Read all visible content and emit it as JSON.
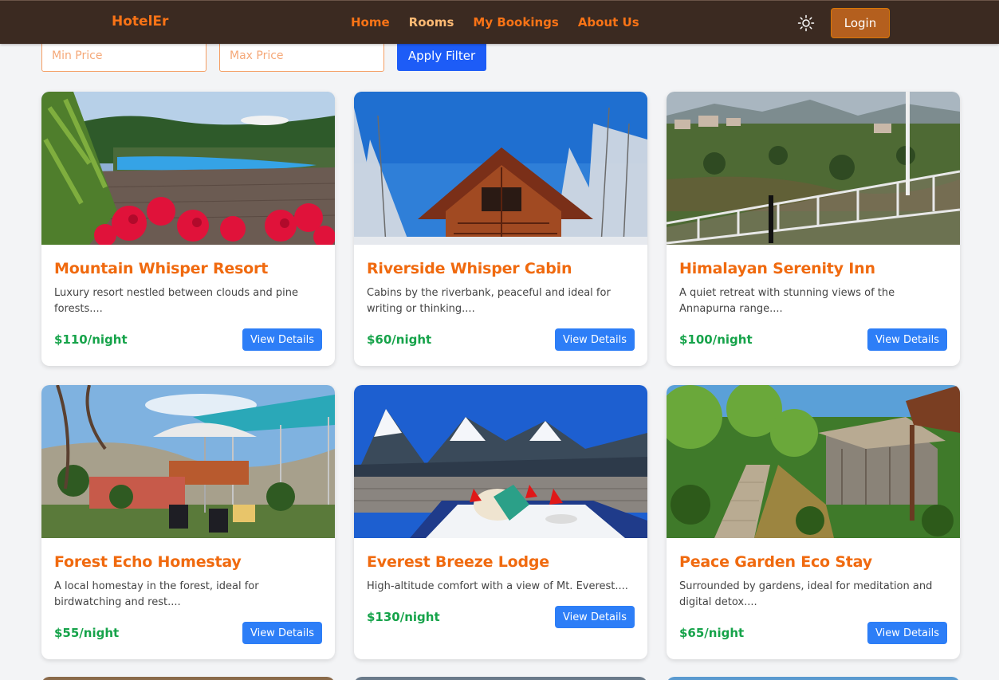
{
  "navbar": {
    "brand": "HotelEr",
    "links": [
      {
        "label": "Home"
      },
      {
        "label": "Rooms"
      },
      {
        "label": "My Bookings"
      },
      {
        "label": "About Us"
      }
    ],
    "login_label": "Login"
  },
  "filter": {
    "min_placeholder": "Min Price",
    "max_placeholder": "Max Price",
    "apply_label": "Apply Filter"
  },
  "button_label": "View Details",
  "rooms": [
    {
      "title": "Mountain Whisper Resort",
      "description": "Luxury resort nestled between clouds and pine forests....",
      "price": "$110/night",
      "image": "pool-flowers"
    },
    {
      "title": "Riverside Whisper Cabin",
      "description": "Cabins by the riverbank, peaceful and ideal for writing or thinking....",
      "price": "$60/night",
      "image": "snow-cabin"
    },
    {
      "title": "Himalayan Serenity Inn",
      "description": "A quiet retreat with stunning views of the Annapurna range....",
      "price": "$100/night",
      "image": "valley-balcony"
    },
    {
      "title": "Forest Echo Homestay",
      "description": "A local homestay in the forest, ideal for birdwatching and rest....",
      "price": "$55/night",
      "image": "garden-umbrella"
    },
    {
      "title": "Everest Breeze Lodge",
      "description": "High-altitude comfort with a view of Mt. Everest....",
      "price": "$130/night",
      "image": "everest-table"
    },
    {
      "title": "Peace Garden Eco Stay",
      "description": "Surrounded by gardens, ideal for meditation and digital detox....",
      "price": "$65/night",
      "image": "tropical-hut"
    }
  ]
}
